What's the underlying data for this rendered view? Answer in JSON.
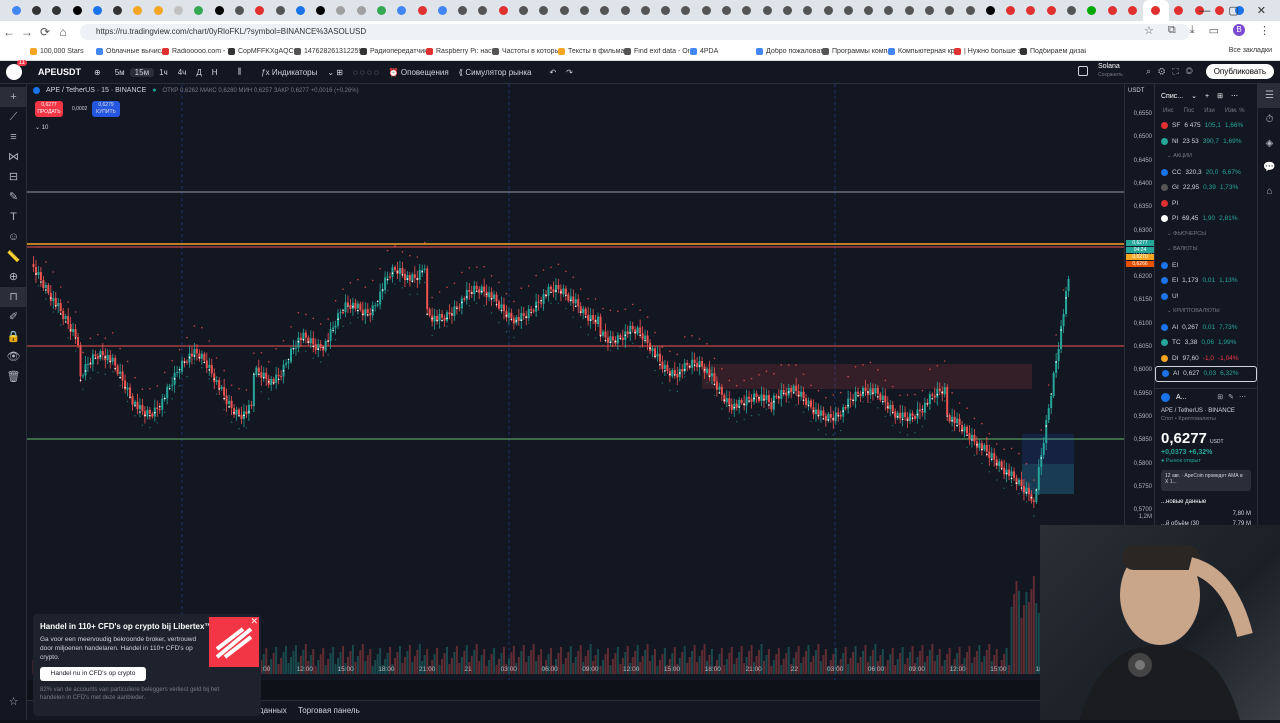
{
  "browser": {
    "url": "https://ru.tradingview.com/chart/0yRloFKL/?symbol=BINANCE%3ASOLUSD",
    "tab_colors": [
      "#4285f4",
      "#333",
      "#333",
      "#000",
      "#1a73e8",
      "#333",
      "#f5a623",
      "#f5a623",
      "#c0c0c0",
      "#34a853",
      "#000",
      "#555",
      "#e03030",
      "#555",
      "#1a73e8",
      "#000",
      "#a0a0a0",
      "#a0a0a0",
      "#34a853",
      "#4285f4",
      "#e03030",
      "#4285f4",
      "#555",
      "#555",
      "#e03030",
      "#555",
      "#555",
      "#555",
      "#555",
      "#555",
      "#555",
      "#555",
      "#555",
      "#555",
      "#555",
      "#555",
      "#555",
      "#555",
      "#555",
      "#555",
      "#555",
      "#555",
      "#555",
      "#555",
      "#555",
      "#555",
      "#555",
      "#555",
      "#000",
      "#e03030",
      "#e03030",
      "#e03030",
      "#555",
      "#0a0",
      "#e03030",
      "#e03030",
      "#e03030",
      "#e03030",
      "#e03030",
      "#e03030",
      "#1a73e8"
    ],
    "bookmarks": [
      "100,000 Stars",
      "Облачные вычисле...",
      "Radiooooo.com - T...",
      "CopMFFKXgAQCtT...",
      "1476282613122595...",
      "Радиопередатчик F...",
      "Raspberry Pi: настр...",
      "Частоты в который...",
      "Тексты в фильмах...",
      "Find exif data - Onli...",
      "4PDA",
      "Добро пожаловать...",
      "Программы компа...",
      "Компьютерная кри...",
      "| Нужно больше зо...",
      "Подбираем дизайн..."
    ],
    "all_bookmarks": "Все закладки",
    "bookmark_colors": [
      "#f5a623",
      "#4285f4",
      "#e03030",
      "#333",
      "#555",
      "#333",
      "#e03030",
      "#555",
      "#f5a623",
      "#555",
      "#4285f4",
      "#4285f4",
      "#555",
      "#4285f4",
      "#e03030",
      "#333"
    ]
  },
  "toolbar": {
    "logo_badge": "11",
    "symbol": "APEUSDT",
    "intervals": [
      "5м",
      "15м",
      "1ч",
      "4ч",
      "Д",
      "Н"
    ],
    "selected_interval": "15м",
    "indicators": "Индикаторы",
    "alerts": "Оповещения",
    "replay": "Симулятор рынка",
    "layout_name": "Solana",
    "layout_sub": "Сохранить",
    "publish": "Опубликовать"
  },
  "legend": {
    "title": "APE / TetherUS · 15 · BINANCE",
    "ohlc": "ОТКР 0,6262  МАКС 0,6280  МИН 0,6257  ЗАКР 0,6277  +0,0016 (+0,26%)",
    "sell_price": "0,6277",
    "sell_label": "ПРОДАТЬ",
    "spread": "0,0002",
    "buy_price": "0,6279",
    "buy_label": "КУПИТЬ",
    "indicator_count": "10"
  },
  "price_axis": {
    "currency": "USDT",
    "labels": [
      "0,6550",
      "0,6500",
      "0,6450",
      "0,6400",
      "0,6350",
      "0,6300",
      "0,6250",
      "0,6200",
      "0,6150",
      "0,6100",
      "0,6050",
      "0,6000",
      "0,5950",
      "0,5900",
      "0,5850",
      "0,5800",
      "0,5750",
      "0,5700"
    ],
    "volume_label": "1,2М",
    "tags": [
      {
        "text": "0,6277",
        "color": "#26a69a"
      },
      {
        "text": "04:24",
        "color": "#26a69a"
      },
      {
        "text": "0,6270",
        "color": "#f5a623"
      },
      {
        "text": "0,6266",
        "color": "#e65100"
      }
    ]
  },
  "time_axis": [
    "9:00",
    "12:00",
    "15:00",
    "18:00",
    "21:00",
    "21",
    "03:00",
    "06:00",
    "09:00",
    "12:00",
    "15:00",
    "18:00",
    "21:00",
    "22",
    "03:00",
    "06:00",
    "09:00",
    "12:00",
    "15:00",
    "18"
  ],
  "bottom_bar": {
    "tab1": "данных",
    "tab2": "Торговая панель"
  },
  "ad": {
    "title": "Handel in 110+ CFD's op crypto bij Libertex™",
    "body": "Ga voor een meervoudig bekroonde broker, vertrouwd door miljoenen handelaren. Handel in 110+ CFD's op crypto.",
    "button": "Handel nu in CFD's op crypto",
    "disclaimer": "82% van de accounts van particuliere beleggers verliest geld bij het handelen in CFD's met deze aanbieder."
  },
  "watchlist": {
    "title": "Спис...",
    "columns": [
      "Инс",
      "Пос",
      "Изи",
      "Изм. %"
    ],
    "rows": [
      {
        "type": "row",
        "sym": "SF",
        "last": "6 475",
        "chg": "105,1",
        "pct": "1,66%",
        "color": "#e03030",
        "dir": "pos"
      },
      {
        "type": "row",
        "sym": "NI",
        "last": "23 53",
        "chg": "390,7",
        "pct": "1,69%",
        "color": "#26a69a",
        "dir": "pos"
      },
      {
        "type": "section",
        "label": "АКЦИИ"
      },
      {
        "type": "row",
        "sym": "CC",
        "last": "320,3",
        "chg": "20,0",
        "pct": "6,67%",
        "color": "#1a73e8",
        "dir": "pos"
      },
      {
        "type": "row",
        "sym": "GI",
        "last": "22,95",
        "chg": "0,39",
        "pct": "1,73%",
        "color": "#555",
        "dir": "pos"
      },
      {
        "type": "row",
        "sym": "PI",
        "last": "",
        "chg": "",
        "pct": "",
        "color": "#e03030",
        "dir": "neg"
      },
      {
        "type": "row",
        "sym": "PI",
        "last": "69,45",
        "chg": "1,90",
        "pct": "2,81%",
        "color": "#fff",
        "dir": "pos"
      },
      {
        "type": "section",
        "label": "ФЬЮЧЕРСЫ"
      },
      {
        "type": "section",
        "label": "ВАЛЮТЫ"
      },
      {
        "type": "row",
        "sym": "EI",
        "last": "",
        "chg": "",
        "pct": "",
        "color": "#1a73e8",
        "dir": "pos"
      },
      {
        "type": "row",
        "sym": "EI",
        "last": "1,173",
        "chg": "0,01",
        "pct": "1,13%",
        "color": "#1a73e8",
        "dir": "pos"
      },
      {
        "type": "row",
        "sym": "U!",
        "last": "",
        "chg": "",
        "pct": "",
        "color": "#1a73e8",
        "dir": "pos"
      },
      {
        "type": "section",
        "label": "КРИПТОВАЛЮТЫ"
      },
      {
        "type": "row",
        "sym": "AI",
        "last": "0,267",
        "chg": "0,01",
        "pct": "7,73%",
        "color": "#1a73e8",
        "dir": "pos"
      },
      {
        "type": "row",
        "sym": "TC",
        "last": "3,38",
        "chg": "0,06",
        "pct": "1,99%",
        "color": "#26a69a",
        "dir": "pos"
      },
      {
        "type": "row",
        "sym": "DI",
        "last": "97,60",
        "chg": "-1,0",
        "pct": "-1,04%",
        "color": "#f5a623",
        "dir": "neg"
      },
      {
        "type": "row",
        "sym": "AI",
        "last": "0,627",
        "chg": "0,03",
        "pct": "6,32%",
        "color": "#1a73e8",
        "dir": "pos",
        "highlight": true
      }
    ]
  },
  "detail": {
    "short": "A...",
    "name": "APE / TetherUS",
    "exchange": "BINANCE",
    "category": "Спот • Криптовалюты",
    "price": "0,6277",
    "currency": "USDT",
    "change": "+0,0373  +6,32%",
    "status": "Рынок открыт",
    "news": "12 авг. · ApeCoin проведет АМА в X 1...",
    "section": "...новые данные",
    "v1": "7,80 M",
    "v2label": "...й объём (30",
    "v2": "7,79 M"
  }
}
